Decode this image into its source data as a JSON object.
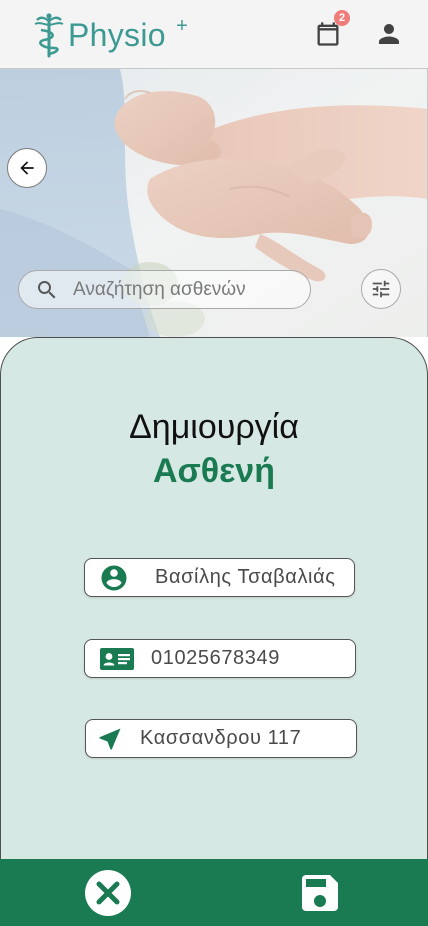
{
  "app": {
    "logo_text": "Physio",
    "logo_plus": "+",
    "brand_color": "#3d9a92",
    "accent_color": "#1a7a52"
  },
  "header": {
    "calendar_icon": "calendar-icon",
    "calendar_badge": "2",
    "account_icon": "person-icon"
  },
  "hero": {
    "back_icon": "arrow-left-icon",
    "search_placeholder": "Αναζήτηση ασθενών",
    "search_icon": "search-icon",
    "filter_icon": "tune-sliders-icon"
  },
  "form": {
    "title_line1": "Δημιουργία",
    "title_line2": "Ασθενή",
    "name_value": "Βασίλης Τσαβαλιάς",
    "name_icon": "account-circle-icon",
    "id_value": "01025678349",
    "id_icon": "id-card-icon",
    "address_value": "Κασσανδρου 117",
    "address_icon": "navigation-arrow-icon",
    "background_color": "#d6e8e3"
  },
  "bottombar": {
    "cancel_icon": "cancel-circle-icon",
    "save_icon": "save-floppy-icon"
  }
}
